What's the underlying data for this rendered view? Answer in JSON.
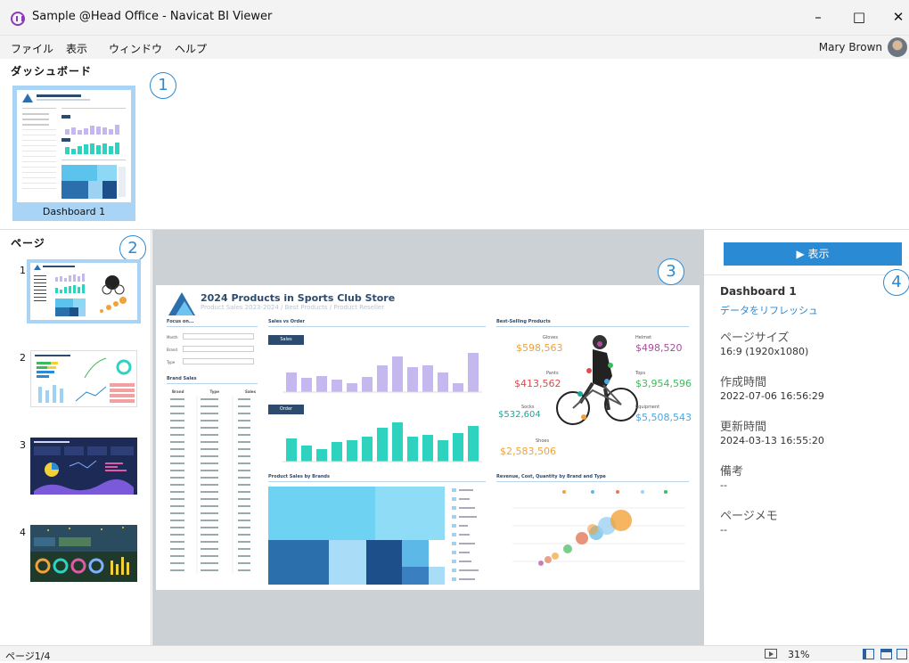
{
  "window": {
    "title": "Sample @Head Office - Navicat BI Viewer",
    "controls": [
      "–",
      "□",
      "✕"
    ]
  },
  "menu": [
    "ファイル",
    "表示",
    "ウィンドウ",
    "ヘルプ"
  ],
  "user": {
    "name": "Mary Brown",
    "icon": "avatar-icon"
  },
  "dashboards": {
    "heading": "ダッシュボード",
    "items": [
      {
        "label": "Dashboard 1",
        "selected": true
      }
    ]
  },
  "pages": {
    "heading": "ページ",
    "items": [
      {
        "num": "1",
        "selected": true
      },
      {
        "num": "2"
      },
      {
        "num": "3"
      },
      {
        "num": "4"
      }
    ]
  },
  "callouts": [
    "1",
    "2",
    "3",
    "4"
  ],
  "preview": {
    "title": "2024 Products in Sports Club Store",
    "subtitle": "Product Sales 2023-2024 / Best Products / Product Reseller",
    "sections": [
      "Focus on...",
      "Sales vs Order",
      "Best-Selling Products",
      "Brand Sales",
      "Product Sales by Brands",
      "Revenue, Cost, Quantity by Brand and Type"
    ],
    "filters": [
      "Month",
      "Brand",
      "Type"
    ],
    "table_header": [
      "Brand",
      "Type",
      "Sales"
    ],
    "sales_button": "Sales",
    "order_button": "Order",
    "best_selling": [
      {
        "label": "Gloves",
        "value": "$598,563",
        "color": "#f2a23a"
      },
      {
        "label": "Helmet",
        "value": "$498,520",
        "color": "#b04a9e"
      },
      {
        "label": "Pants",
        "value": "$413,562",
        "color": "#e14b4b"
      },
      {
        "label": "Tops",
        "value": "$3,954,596",
        "color": "#3dbb5a"
      },
      {
        "label": "Socks",
        "value": "$532,604",
        "color": "#1aa89a"
      },
      {
        "label": "Equipment",
        "value": "$5,508,543",
        "color": "#4aa8e0"
      },
      {
        "label": "Shoes",
        "value": "$2,583,506",
        "color": "#f2a23a"
      }
    ]
  },
  "side": {
    "show_button": "▶ 表示",
    "dashboard_name": "Dashboard 1",
    "refresh": "データをリフレッシュ",
    "props": [
      {
        "label": "ページサイズ",
        "value": "16:9 (1920x1080)"
      },
      {
        "label": "作成時間",
        "value": "2022-07-06 16:56:29"
      },
      {
        "label": "更新時間",
        "value": "2024-03-13 16:55:20"
      },
      {
        "label": "備考",
        "value": "--"
      },
      {
        "label": "ページメモ",
        "value": "--"
      }
    ]
  },
  "status": {
    "page": "ページ1/4",
    "zoom": "31%"
  }
}
